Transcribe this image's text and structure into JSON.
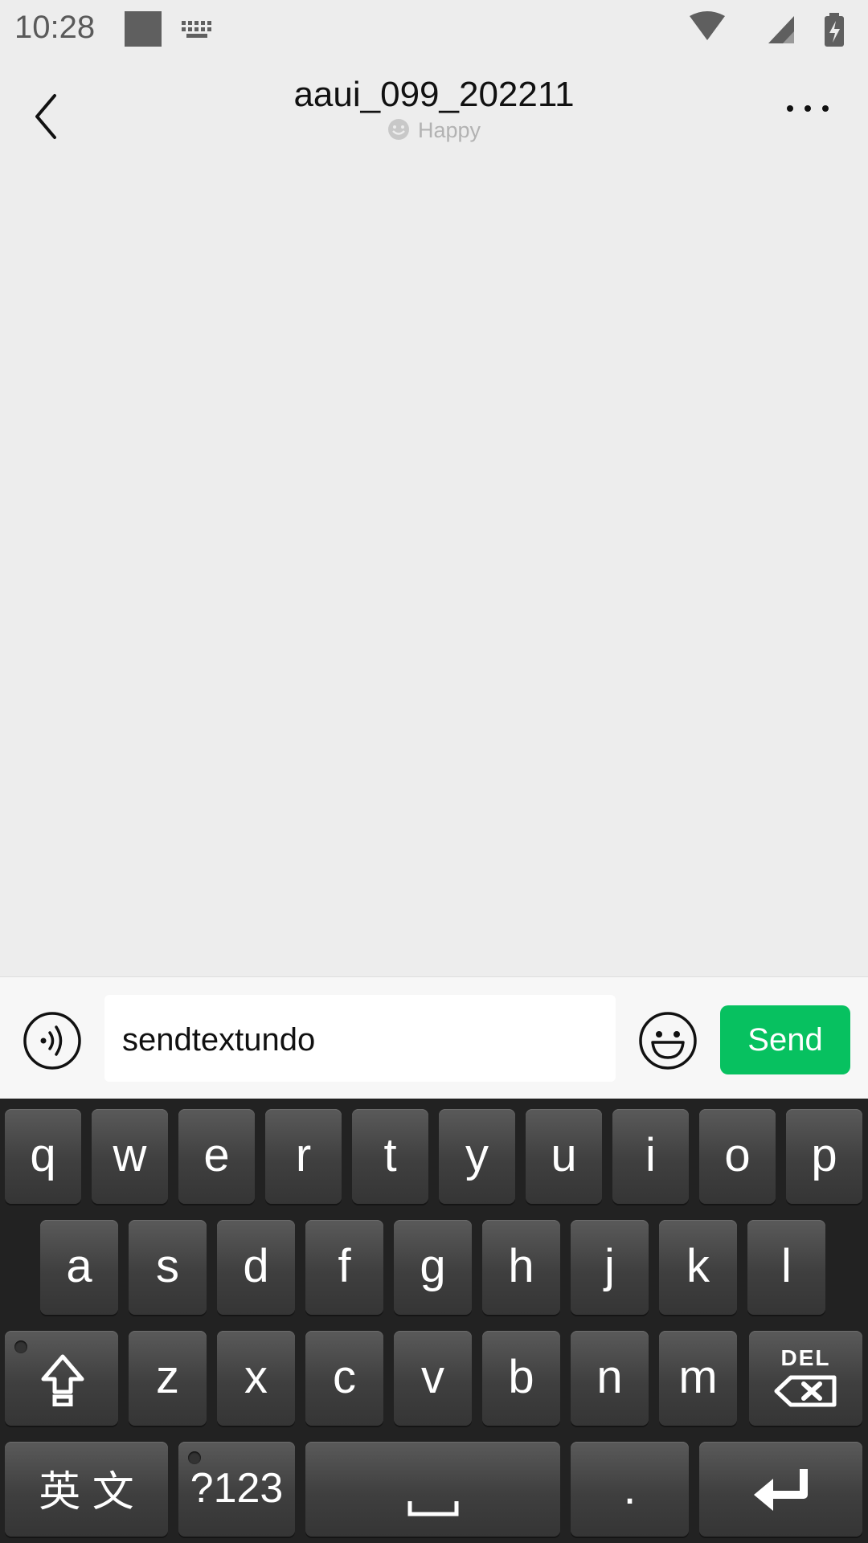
{
  "status_bar": {
    "time": "10:28"
  },
  "header": {
    "title": "aaui_099_202211",
    "status": "Happy"
  },
  "input": {
    "value": "sendtextundo",
    "send_label": "Send"
  },
  "keyboard": {
    "row1": [
      "q",
      "w",
      "e",
      "r",
      "t",
      "y",
      "u",
      "i",
      "o",
      "p"
    ],
    "row2": [
      "a",
      "s",
      "d",
      "f",
      "g",
      "h",
      "j",
      "k",
      "l"
    ],
    "row3": [
      "z",
      "x",
      "c",
      "v",
      "b",
      "n",
      "m"
    ],
    "del_label": "DEL",
    "lang_label": "英 文",
    "symbols_label": "?123",
    "period_label": "."
  },
  "colors": {
    "send": "#07c160",
    "background": "#ededed"
  }
}
